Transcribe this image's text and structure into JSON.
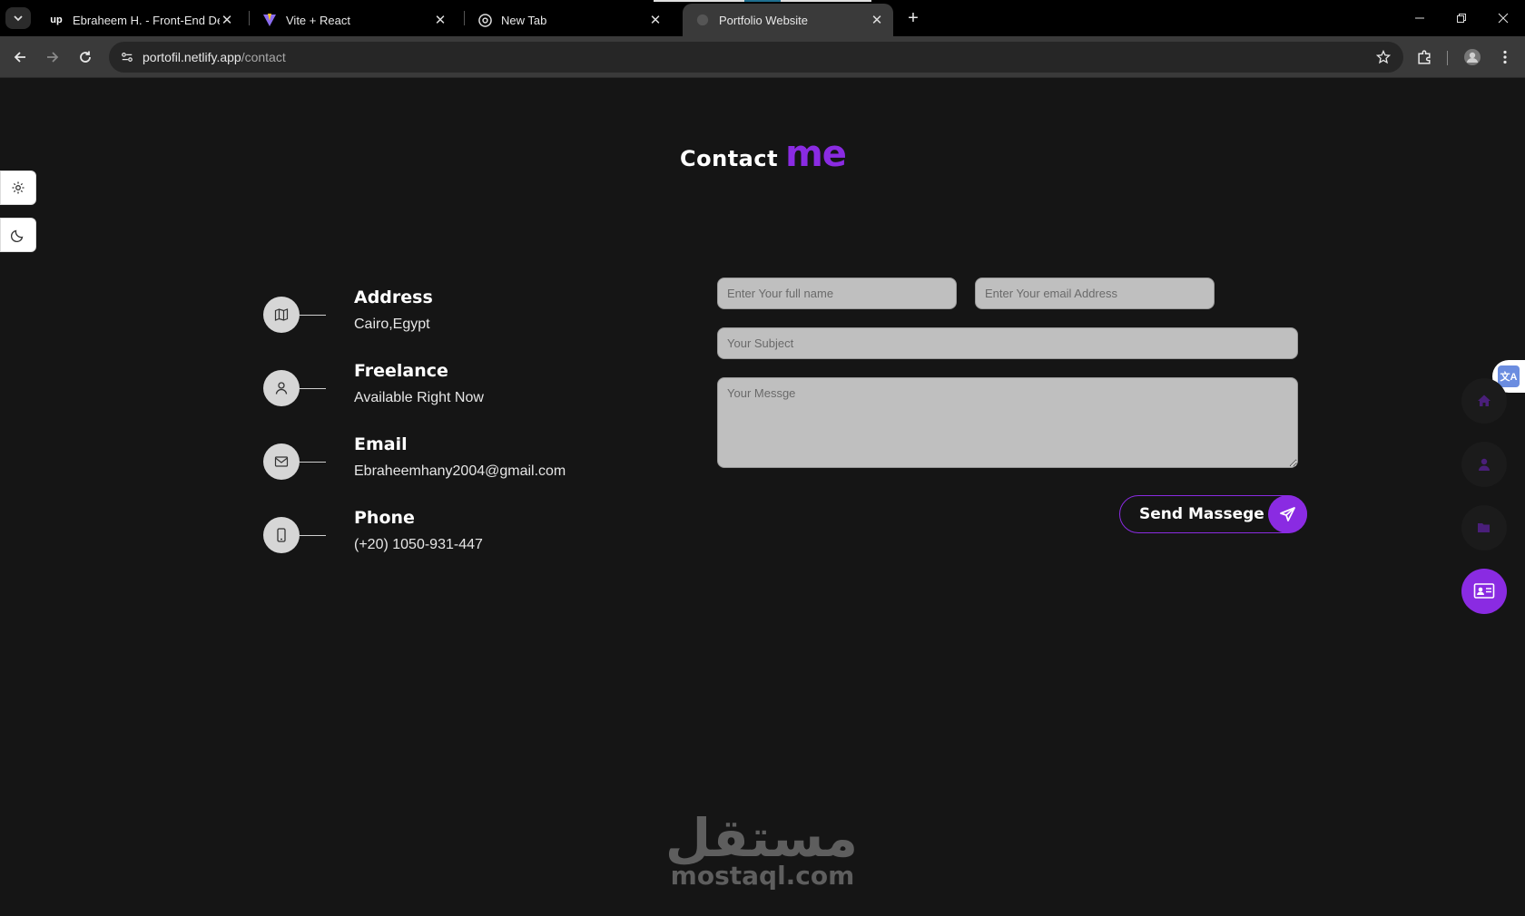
{
  "browser": {
    "tabs": [
      {
        "title": "Ebraheem H. - Front-End Devel",
        "favicon": "upwork-icon",
        "active": false
      },
      {
        "title": "Vite + React",
        "favicon": "vite-icon",
        "active": false
      },
      {
        "title": "New Tab",
        "favicon": "chrome-icon",
        "active": false
      },
      {
        "title": "Portfolio Website",
        "favicon": "globe-icon",
        "active": true
      }
    ],
    "url_host": "portofil.netlify.app",
    "url_path": "/contact"
  },
  "page": {
    "heading_word1": "Contact",
    "heading_word2": "me",
    "accent_color": "#8a2be2",
    "info": [
      {
        "title": "Address",
        "text": "Cairo,Egypt",
        "icon": "map-icon"
      },
      {
        "title": "Freelance",
        "text": "Available Right Now",
        "icon": "user-icon"
      },
      {
        "title": "Email",
        "text": "Ebraheemhany2004@gmail.com",
        "icon": "mail-icon"
      },
      {
        "title": "Phone",
        "text": "(+20) 1050-931-447",
        "icon": "phone-icon"
      }
    ],
    "form": {
      "name_placeholder": "Enter Your full name",
      "email_placeholder": "Enter Your email Address",
      "subject_placeholder": "Your Subject",
      "message_placeholder": "Your Messge",
      "send_label": "Send Massege"
    },
    "right_nav": [
      {
        "name": "home-icon",
        "active": false
      },
      {
        "name": "user-icon",
        "active": false
      },
      {
        "name": "folder-icon",
        "active": false
      },
      {
        "name": "contact-card-icon",
        "active": true
      }
    ],
    "watermark_arabic": "مستقل",
    "watermark_latin": "mostaql.com"
  }
}
